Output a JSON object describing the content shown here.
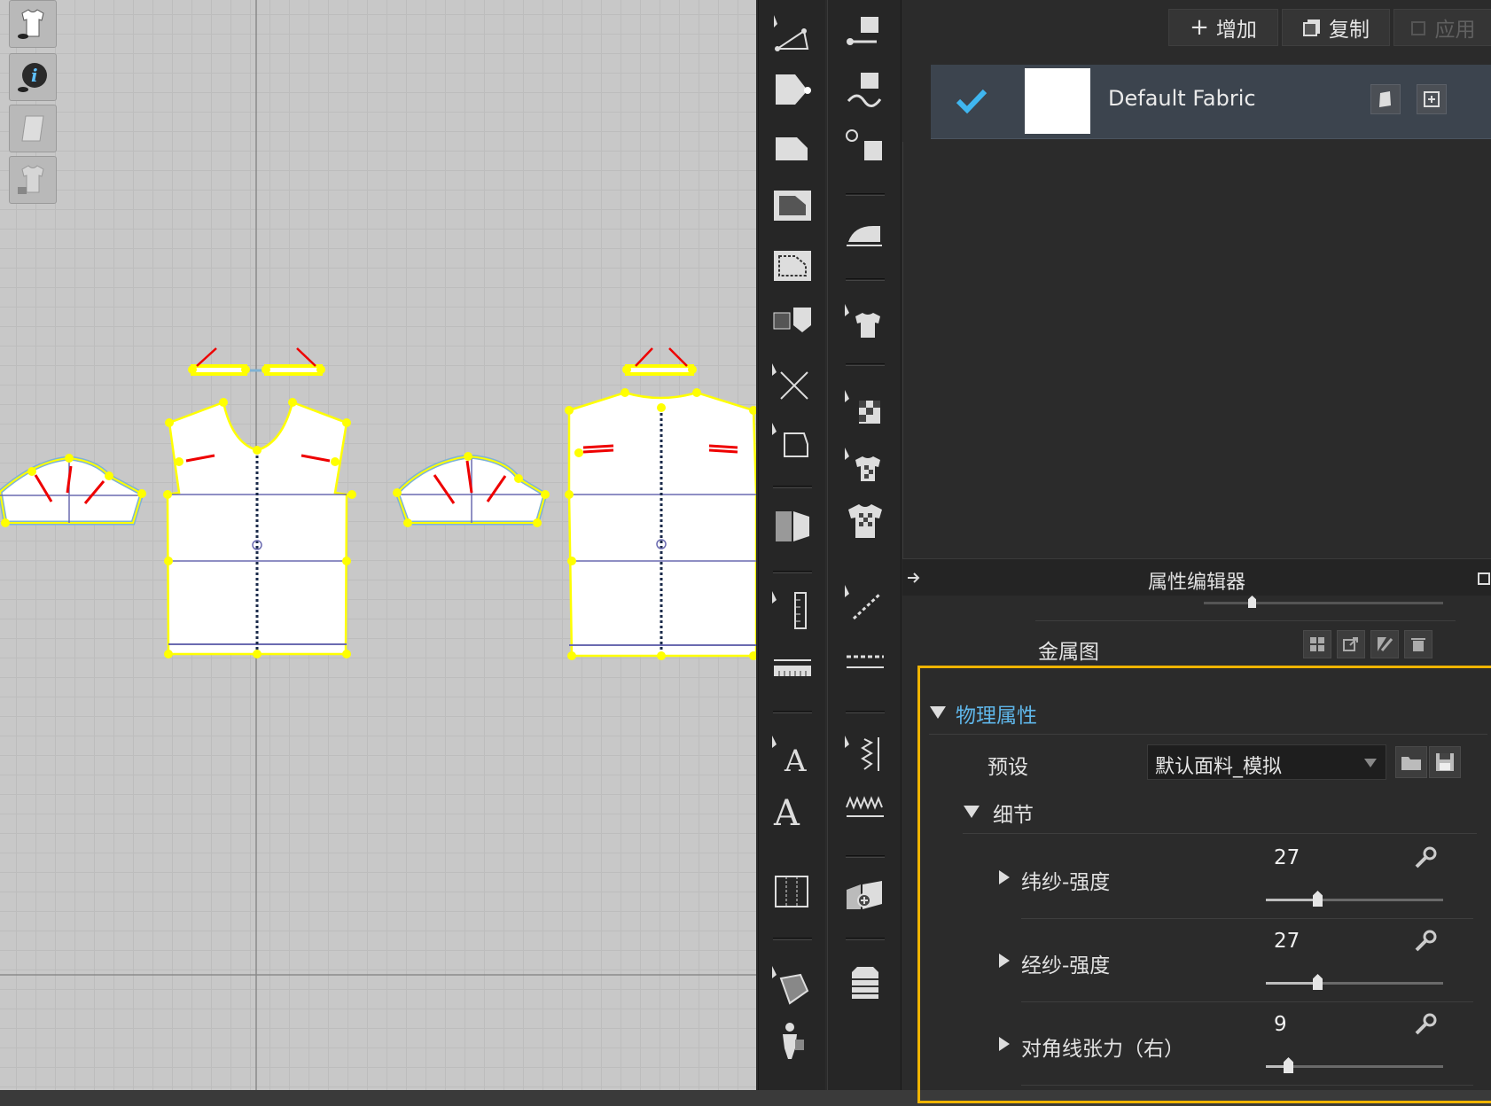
{
  "canvas": {
    "view_buttons": [
      {
        "name": "show-garment-icon"
      },
      {
        "name": "info-icon"
      },
      {
        "name": "pattern-icon"
      },
      {
        "name": "lock-garment-icon"
      }
    ]
  },
  "toolbar_a": [
    "edit-pattern-icon",
    "edit-point-icon",
    "polygon-icon",
    "rectangle-icon",
    "internal-rectangle-icon",
    "fold-pattern-icon",
    "segment-icon",
    "trace-icon",
    "symmetric-pattern-icon",
    "ruler-icon",
    "tape-measure-icon",
    "text-edit-icon",
    "text-icon",
    "grid-icon",
    "multi-tool-icon",
    "avatar-tool-icon"
  ],
  "toolbar_b": [
    "seam-line-icon",
    "free-seam-icon",
    "check-seam-icon",
    "iron-icon",
    "select-garment-icon",
    "texture-icon",
    "fabric-pattern-icon",
    "checkered-garment-icon",
    "internal-line-icon",
    "dashed-line-icon",
    "elastic-icon",
    "zigzag-icon",
    "puzzle-piece-icon",
    "puffer-icon"
  ],
  "fabric_panel": {
    "add_label": "增加",
    "copy_label": "复制",
    "apply_label": "应用",
    "fabric_name": "Default Fabric"
  },
  "property_editor": {
    "title": "属性编辑器",
    "metal_map_label": "金属图",
    "physical_section": "物理属性",
    "preset_label": "预设",
    "preset_value": "默认面料_模拟",
    "detail_section": "细节",
    "properties": [
      {
        "label": "纬纱-强度",
        "value": "27",
        "fraction": 0.29
      },
      {
        "label": "经纱-强度",
        "value": "27",
        "fraction": 0.29
      },
      {
        "label": "对角线张力（右）",
        "value": "9",
        "fraction": 0.12
      }
    ]
  },
  "colors": {
    "highlight": "#f0b400",
    "accent": "#5fb6e9",
    "check": "#3fb6f0"
  }
}
